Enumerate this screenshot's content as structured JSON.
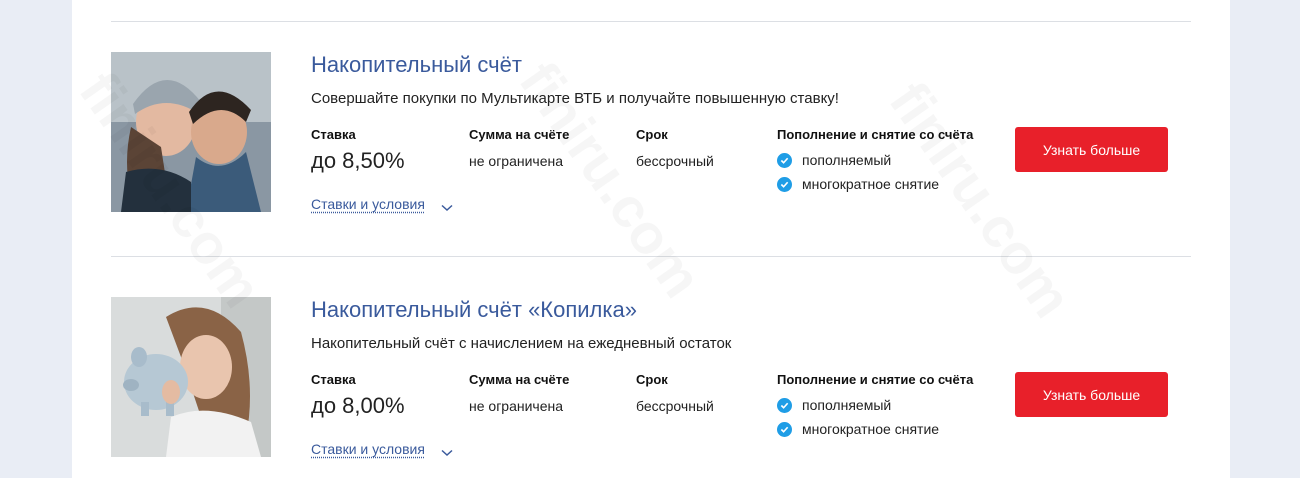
{
  "products": [
    {
      "title": "Накопительный счёт",
      "description": "Совершайте покупки по Мультикарте ВТБ и получайте повышенную ставку!",
      "rate_label": "Ставка",
      "rate_value": "до 8,50%",
      "sum_label": "Сумма на счёте",
      "sum_value": "не ограничена",
      "term_label": "Срок",
      "term_value": "бессрочный",
      "replenish_label": "Пополнение и снятие со счёта",
      "features": [
        "пополняемый",
        "многократное снятие"
      ],
      "terms_link": "Ставки и условия",
      "cta": "Узнать больше"
    },
    {
      "title": "Накопительный счёт «Копилка»",
      "description": "Накопительный счёт с начислением на ежедневный остаток",
      "rate_label": "Ставка",
      "rate_value": "до 8,00%",
      "sum_label": "Сумма на счёте",
      "sum_value": "не ограничена",
      "term_label": "Срок",
      "term_value": "бессрочный",
      "replenish_label": "Пополнение и снятие со счёта",
      "features": [
        "пополняемый",
        "многократное снятие"
      ],
      "terms_link": "Ставки и условия",
      "cta": "Узнать больше"
    }
  ],
  "watermark": "finiru.com",
  "colors": {
    "accent_blue": "#3a5a9c",
    "cta_red": "#e8202a",
    "check_blue": "#1f9de6"
  },
  "icons": [
    "check-icon",
    "chevron-down-icon"
  ]
}
